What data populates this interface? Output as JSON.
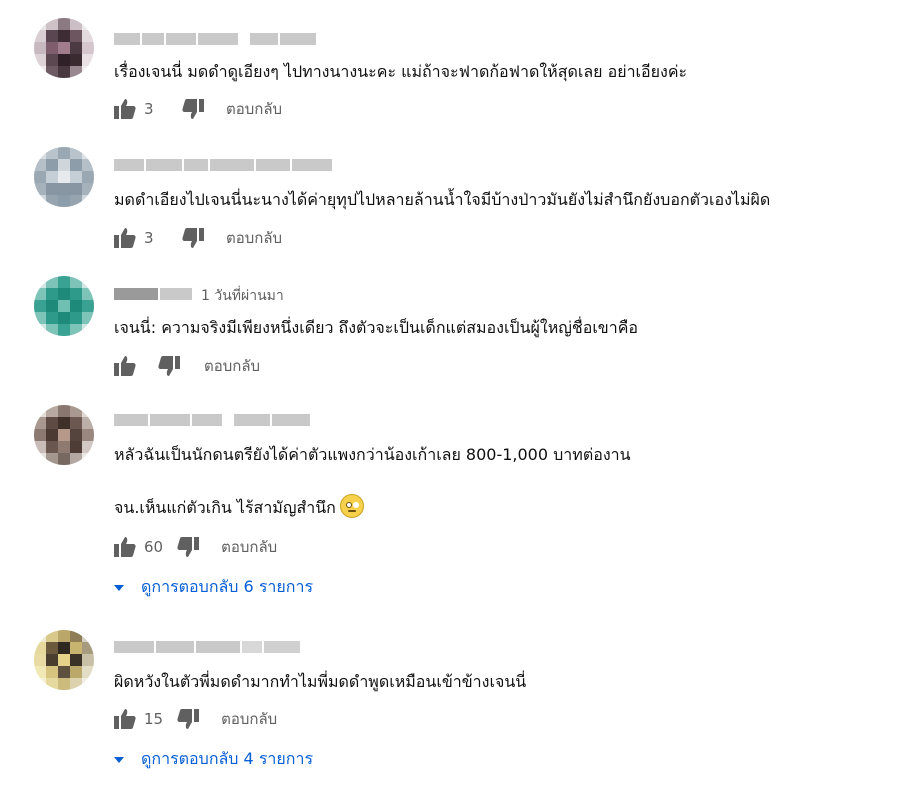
{
  "comments": [
    {
      "time_ago": "",
      "text_lines": [
        "เรื่องเจนนี่ มดดำดูเอียงๆ ไปทางนางนะคะ แม่ถ้าจะฟาดก้อฟาดให้สุดเลย อย่าเอียงค่ะ"
      ],
      "likes": "3",
      "reply_label": "ตอบกลับ",
      "view_replies": ""
    },
    {
      "time_ago": "",
      "text_lines": [
        "มดดำเอียงไปเจนนี่นะนางได้ค่ายุทุปไปหลายล้านน้ำใจมีบ้างป่าวมันยังไม่สำนึกยังบอกตัวเองไม่ผิด"
      ],
      "likes": "3",
      "reply_label": "ตอบกลับ",
      "view_replies": ""
    },
    {
      "time_ago": "1 วันที่ผ่านมา",
      "text_lines": [
        "เจนนี่: ความจริงมีเพียงหนึ่งเดียว ถึงตัวจะเป็นเด็กแต่สมองเป็นผู้ใหญ่ชื่อเขาคือ"
      ],
      "likes": "",
      "reply_label": "ตอบกลับ",
      "view_replies": ""
    },
    {
      "time_ago": "",
      "text_lines": [
        "หลัวฉันเป็นนักดนตรียังได้ค่าตัวแพงกว่าน้องเก้าเลย 800-1,000 บาทต่องาน",
        "จน.เห็นแก่ตัวเกิน ไร้สามัญสำนึก"
      ],
      "emoji": "face-with-rolling-eyes",
      "likes": "60",
      "reply_label": "ตอบกลับ",
      "view_replies": "ดูการตอบกลับ 6 รายการ"
    },
    {
      "time_ago": "",
      "text_lines": [
        "ผิดหวังในตัวพี่มดดำมากทำไมพี่มดดำพูดเหมือนเข้าข้างเจนนี่"
      ],
      "likes": "15",
      "reply_label": "ตอบกลับ",
      "view_replies": "ดูการตอบกลับ 4 รายการ"
    }
  ],
  "colors": {
    "text": "#0f0f0f",
    "secondary": "#606060",
    "link": "#065fd4",
    "icon": "#606060"
  }
}
